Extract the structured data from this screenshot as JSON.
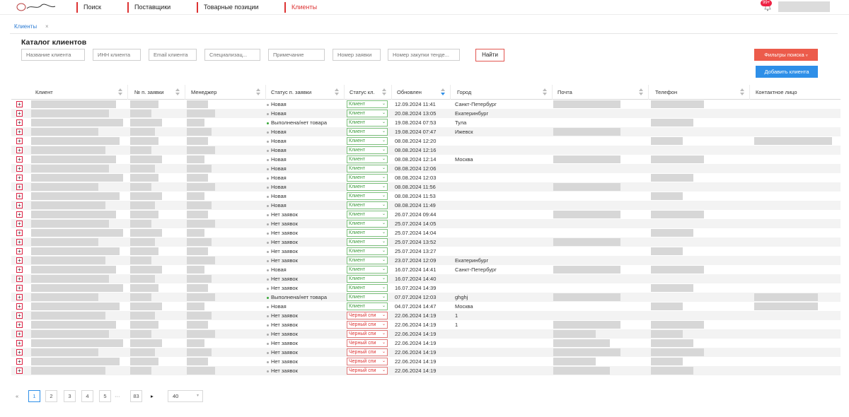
{
  "nav": {
    "items": [
      "Поиск",
      "Поставщики",
      "Товарные позиции",
      "Клиенты"
    ],
    "badge": "99+"
  },
  "tab": {
    "label": "Клиенты",
    "close": "×"
  },
  "page_title": "Каталог клиентов",
  "filters": {
    "placeholders": [
      "Название клиента",
      "ИНН клиента",
      "Email клиента",
      "Специализац...",
      "Примечание",
      "Номер заявки",
      "Номер закупки тенде..."
    ],
    "find": "Найти",
    "search_filters": "Фильтры поиска",
    "add_client": "Добавить клиента"
  },
  "columns": [
    "Клиент",
    "№ п. заявки",
    "Менеджер",
    "Статус п. заявки",
    "Статус кл.",
    "Обновлен",
    "Город",
    "Почта",
    "Телефон",
    "Контактное лицо"
  ],
  "rows": [
    {
      "status": "Новая",
      "dot": "gray",
      "client_status": "Клиент",
      "updated": "12.09.2024 11:41",
      "city": "Санкт-Петербург"
    },
    {
      "status": "Новая",
      "dot": "gray",
      "client_status": "Клиент",
      "updated": "20.08.2024 13:05",
      "city": "Екатеринбург"
    },
    {
      "status": "Выполнена/нет товара",
      "dot": "green",
      "client_status": "Клиент",
      "updated": "19.08.2024 07:53",
      "city": "Тула"
    },
    {
      "status": "Новая",
      "dot": "gray",
      "client_status": "Клиент",
      "updated": "19.08.2024 07:47",
      "city": "Ижевск"
    },
    {
      "status": "Новая",
      "dot": "gray",
      "client_status": "Клиент",
      "updated": "08.08.2024 12:20",
      "city": ""
    },
    {
      "status": "Новая",
      "dot": "gray",
      "client_status": "Клиент",
      "updated": "08.08.2024 12:16",
      "city": ""
    },
    {
      "status": "Новая",
      "dot": "gray",
      "client_status": "Клиент",
      "updated": "08.08.2024 12:14",
      "city": "Москва"
    },
    {
      "status": "Новая",
      "dot": "gray",
      "client_status": "Клиент",
      "updated": "08.08.2024 12:06",
      "city": ""
    },
    {
      "status": "Новая",
      "dot": "gray",
      "client_status": "Клиент",
      "updated": "08.08.2024 12:03",
      "city": ""
    },
    {
      "status": "Новая",
      "dot": "gray",
      "client_status": "Клиент",
      "updated": "08.08.2024 11:56",
      "city": ""
    },
    {
      "status": "Новая",
      "dot": "gray",
      "client_status": "Клиент",
      "updated": "08.08.2024 11:53",
      "city": ""
    },
    {
      "status": "Новая",
      "dot": "gray",
      "client_status": "Клиент",
      "updated": "08.08.2024 11:49",
      "city": ""
    },
    {
      "status": "Нет заявок",
      "dot": "gray",
      "client_status": "Клиент",
      "updated": "26.07.2024 09:44",
      "city": ""
    },
    {
      "status": "Нет заявок",
      "dot": "gray",
      "client_status": "Клиент",
      "updated": "25.07.2024 14:05",
      "city": ""
    },
    {
      "status": "Нет заявок",
      "dot": "gray",
      "client_status": "Клиент",
      "updated": "25.07.2024 14:04",
      "city": ""
    },
    {
      "status": "Нет заявок",
      "dot": "gray",
      "client_status": "Клиент",
      "updated": "25.07.2024 13:52",
      "city": ""
    },
    {
      "status": "Нет заявок",
      "dot": "gray",
      "client_status": "Клиент",
      "updated": "25.07.2024 13:27",
      "city": ""
    },
    {
      "status": "Нет заявок",
      "dot": "gray",
      "client_status": "Клиент",
      "updated": "23.07.2024 12:09",
      "city": "Екатеринбург"
    },
    {
      "status": "Новая",
      "dot": "gray",
      "client_status": "Клиент",
      "updated": "16.07.2024 14:41",
      "city": "Санкт-Петербург"
    },
    {
      "status": "Нет заявок",
      "dot": "gray",
      "client_status": "Клиент",
      "updated": "16.07.2024 14:40",
      "city": ""
    },
    {
      "status": "Нет заявок",
      "dot": "gray",
      "client_status": "Клиент",
      "updated": "16.07.2024 14:39",
      "city": ""
    },
    {
      "status": "Выполнена/нет товара",
      "dot": "green",
      "client_status": "Клиент",
      "updated": "07.07.2024 12:03",
      "city": "ghghj"
    },
    {
      "status": "Новая",
      "dot": "gray",
      "client_status": "Клиент",
      "updated": "04.07.2024 14:47",
      "city": "Москва"
    },
    {
      "status": "Нет заявок",
      "dot": "gray",
      "client_status": "Черный спи",
      "updated": "22.06.2024 14:19",
      "city": "1"
    },
    {
      "status": "Нет заявок",
      "dot": "gray",
      "client_status": "Черный спи",
      "updated": "22.06.2024 14:19",
      "city": "1"
    },
    {
      "status": "Нет заявок",
      "dot": "gray",
      "client_status": "Черный спи",
      "updated": "22.06.2024 14:19",
      "city": ""
    },
    {
      "status": "Нет заявок",
      "dot": "gray",
      "client_status": "Черный спи",
      "updated": "22.06.2024 14:19",
      "city": ""
    },
    {
      "status": "Нет заявок",
      "dot": "gray",
      "client_status": "Черный спи",
      "updated": "22.06.2024 14:19",
      "city": ""
    },
    {
      "status": "Нет заявок",
      "dot": "gray",
      "client_status": "Черный спи",
      "updated": "22.06.2024 14:19",
      "city": ""
    },
    {
      "status": "Нет заявок",
      "dot": "gray",
      "client_status": "Черный спи",
      "updated": "22.06.2024 14:19",
      "city": ""
    }
  ],
  "pagination": {
    "pages": [
      "1",
      "2",
      "3",
      "4",
      "5"
    ],
    "ellipsis": "···",
    "last": "83",
    "page_size": "40",
    "current": "1"
  }
}
